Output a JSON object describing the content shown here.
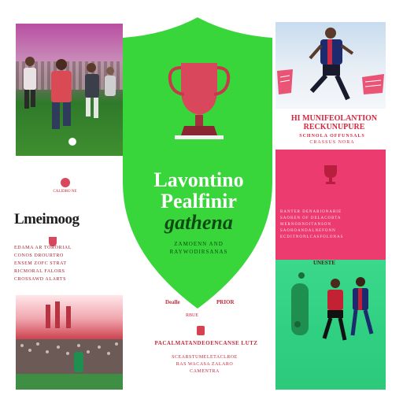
{
  "center": {
    "title_line1": "Lavontino",
    "title_line2": "Pealfinir",
    "title_line3": "gathena",
    "sub_line1": "ZAMOENN AND",
    "sub_line2": "RAYWODIRSANAS"
  },
  "left": {
    "title": "Lmeimoog",
    "small_label": "CALIDRO NE",
    "lines": [
      "EDAMA AR TORORIAL",
      "CONOS DROURTRO",
      "ENSEM ZOFC STRAT",
      "RICMORAL FALORS",
      "CROSSAWD ALARTS"
    ]
  },
  "right": {
    "title": "HI MUNIFEOLANTION RECKUNUPURE",
    "line1": "SCHNOLA OFFUNSALS",
    "line2": "CRASSUS NORA",
    "pink_lines": [
      "RANTER DENARIONARIE",
      "SAOREN OF DELACORTA",
      "MERNORNOITANSON",
      "SAOROANDALNEFONN",
      "ECDITNONLCASFOLONAS"
    ],
    "green_label": "UNESTE"
  },
  "bottom": {
    "a": "Dealle",
    "b": "PRIOR",
    "c": "RBUE",
    "d": "PACALMATANDEOENCANSE LUTZ",
    "e1": "SCEARSTUMELETACLROE",
    "e2": "RAS WACASA ZALARO",
    "e3": "CAMENTRA"
  },
  "colors": {
    "green": "#38d63a",
    "pink": "#ec3b6f",
    "red": "#d3283e",
    "teal": "#2fcf82"
  }
}
